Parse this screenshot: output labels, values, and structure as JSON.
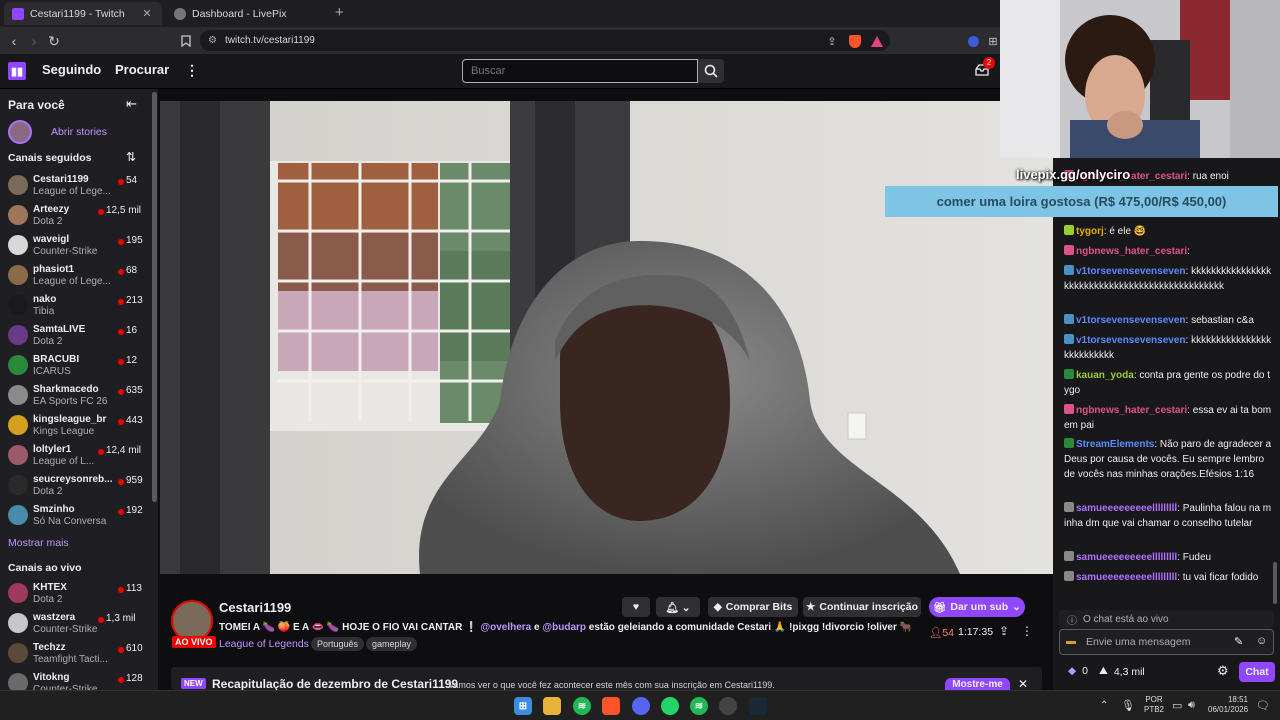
{
  "browser": {
    "tabs": [
      {
        "title": "Cestari1199 - Twitch",
        "active": true
      },
      {
        "title": "Dashboard - LivePix",
        "active": false
      }
    ],
    "new_tab": "+",
    "url": "twitch.tv/cestari1199"
  },
  "topnav": {
    "following": "Seguindo",
    "browse": "Procurar",
    "more": "⋮",
    "search_placeholder": "Buscar",
    "notif_count": "2"
  },
  "sidebar": {
    "for_you": "Para você",
    "stories_label": "Abrir stories",
    "followed_header": "Canais seguidos",
    "followed": [
      {
        "name": "Cestari1199",
        "game": "League of Lege...",
        "viewers": "54",
        "color": "#7a6a5a"
      },
      {
        "name": "Arteezy",
        "game": "Dota 2",
        "viewers": "12,5 mil",
        "color": "#a0765a"
      },
      {
        "name": "waveigl",
        "game": "Counter-Strike",
        "viewers": "195",
        "color": "#d8d8d8"
      },
      {
        "name": "phasiot1",
        "game": "League of Lege...",
        "viewers": "68",
        "color": "#8a6a4a"
      },
      {
        "name": "nako",
        "game": "Tibia",
        "viewers": "213",
        "color": "#1a1a1a"
      },
      {
        "name": "SamtaLIVE",
        "game": "Dota 2",
        "viewers": "16",
        "color": "#6a3a8a"
      },
      {
        "name": "BRACUBI",
        "game": "ICARUS",
        "viewers": "12",
        "color": "#2a8a3a"
      },
      {
        "name": "Sharkmacedo",
        "game": "EA Sports FC 26",
        "viewers": "635",
        "color": "#8a8a8a"
      },
      {
        "name": "kingsleague_br",
        "game": "Kings League",
        "viewers": "443",
        "color": "#d4a020"
      },
      {
        "name": "loltyler1",
        "game": "League of L...",
        "viewers": "12,4 mil",
        "color": "#9a5a6a"
      },
      {
        "name": "seucreysonreb...",
        "game": "Dota 2",
        "viewers": "959",
        "color": "#2a2a2a"
      },
      {
        "name": "Smzinho",
        "game": "Só Na Conversa",
        "viewers": "192",
        "color": "#4a8aaa"
      }
    ],
    "show_more": "Mostrar mais",
    "live_header": "Canais ao vivo",
    "live": [
      {
        "name": "KHTEX",
        "game": "Dota 2",
        "viewers": "113",
        "color": "#a03a5a"
      },
      {
        "name": "wastzera",
        "game": "Counter-Strike",
        "viewers": "1,3 mil",
        "color": "#c8c8c8"
      },
      {
        "name": "Techzz",
        "game": "Teamfight Tacti...",
        "viewers": "610",
        "color": "#5a4a3a"
      },
      {
        "name": "Vitokng",
        "game": "Counter-Strike",
        "viewers": "128",
        "color": "#6a6a6a"
      }
    ]
  },
  "stream": {
    "channel": "Cestari1199",
    "live_badge": "AO VIVO",
    "title_prefix": "TOMEI A 🍆 🍑 E A 👄 🍆 HOJE O FIO VAI CANTAR ❕",
    "mention1": "@ovelhera",
    "and": "e",
    "mention2": "@budarp",
    "title_suffix": "estão geleiando a comunidade Cestari 🙏 !pixgg !divorcio !oliver 🐂",
    "game": "League of Legends",
    "tags": [
      "Português",
      "gameplay"
    ],
    "viewers": "54",
    "uptime": "1:17:35",
    "buttons": {
      "bits": "Comprar Bits",
      "sub": "Continuar inscrição",
      "gift": "Dar um sub"
    },
    "recap_badge": "NEW",
    "recap_title": "Recapitulação de dezembro de Cestari1199",
    "recap_text": "Vamos ver o que você fez acontecer este mês com sua inscrição em Cestari1199.",
    "recap_button": "Mostre-me"
  },
  "overlay": {
    "handle": "livepix.gg/onlyciro",
    "goal": "comer uma loira gostosa (R$ 475,00/R$ 450,00)"
  },
  "chat": {
    "messages": [
      {
        "user": "ngbnews_hater_cestari",
        "color": "#e0508a",
        "text": ": rua enoi"
      },
      {
        "user": "tygorj",
        "color": "#e0b000",
        "text": ": é ele 🤓"
      },
      {
        "user": "ngbnews_hater_cestari",
        "color": "#e0508a",
        "text": ":"
      },
      {
        "user": "v1torsevensevenseven",
        "color": "#5a8aff",
        "text": ": kkkkkkkkkkkkkkkkkkkkkkkkkkkkkkkkkkkkkkkkkkkkkkkk"
      },
      {
        "user": "v1torsevensevenseven",
        "color": "#5a8aff",
        "text": ": sebastian c&a"
      },
      {
        "user": "v1torsevensevenseven",
        "color": "#5a8aff",
        "text": ": kkkkkkkkkkkkkkkkkkkkkkkkkk"
      },
      {
        "user": "kauan_yoda",
        "color": "#9acd32",
        "text": ": conta pra gente os podre do tygo"
      },
      {
        "user": "ngbnews_hater_cestari",
        "color": "#e0508a",
        "text": ": essa ev ai ta bom em pai"
      },
      {
        "user": "StreamElements",
        "color": "#5a8aff",
        "text": ": Não paro de agradecer a Deus por causa de vocês. Eu sempre lembro de vocês nas minhas orações.Efésios 1:16"
      },
      {
        "user": "samueeeeeeeeelllllllll",
        "color": "#b070ff",
        "text": ": Paulinha falou na minha dm que vai chamar o conselho tutelar"
      },
      {
        "user": "samueeeeeeeeelllllllll",
        "color": "#b070ff",
        "text": ": Fudeu"
      },
      {
        "user": "samueeeeeeeeelllllllll",
        "color": "#b070ff",
        "text": ": tu vai ficar fodido"
      }
    ],
    "live_notice": "O chat está ao vivo",
    "input_placeholder": "Envie uma mensagem",
    "points": "0",
    "channel_points": "4,3 mil",
    "chat_button": "Chat"
  },
  "taskbar": {
    "lang": "POR",
    "layout": "PTB2",
    "time": "18:51",
    "date": "06/01/2026"
  }
}
